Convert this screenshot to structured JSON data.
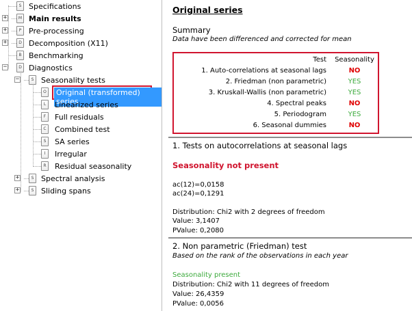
{
  "tree": {
    "items": [
      {
        "label": "Specifications",
        "icon": "S",
        "bold": false
      },
      {
        "label": "Main results",
        "icon": "M",
        "bold": true
      },
      {
        "label": "Pre-processing",
        "icon": "P",
        "bold": false
      },
      {
        "label": "Decomposition (X11)",
        "icon": "D",
        "bold": false
      },
      {
        "label": "Benchmarking",
        "icon": "B",
        "bold": false
      },
      {
        "label": "Diagnostics",
        "icon": "D",
        "bold": false
      },
      {
        "label": "Seasonality tests",
        "icon": "S",
        "bold": false
      },
      {
        "label": "Original (transformed) series",
        "icon": "O",
        "bold": false
      },
      {
        "label": "Linearized series",
        "icon": "L",
        "bold": false
      },
      {
        "label": "Full residuals",
        "icon": "F",
        "bold": false
      },
      {
        "label": "Combined test",
        "icon": "C",
        "bold": false
      },
      {
        "label": "SA series",
        "icon": "S",
        "bold": false
      },
      {
        "label": "Irregular",
        "icon": "I",
        "bold": false
      },
      {
        "label": "Residual seasonality",
        "icon": "R",
        "bold": false
      },
      {
        "label": "Spectral analysis",
        "icon": "S",
        "bold": false
      },
      {
        "label": "Sliding spans",
        "icon": "S",
        "bold": false
      }
    ],
    "expand_plus": "+",
    "expand_minus": "−"
  },
  "content": {
    "title": "Original series",
    "summary_heading": "Summary",
    "summary_note": "Data have been differenced and corrected for mean",
    "table": {
      "col_test": "Test",
      "col_seasonality": "Seasonality",
      "rows": [
        {
          "test": "1. Auto-correlations at seasonal lags",
          "result": "NO"
        },
        {
          "test": "2. Friedman (non parametric)",
          "result": "YES"
        },
        {
          "test": "3. Kruskall-Wallis (non parametric)",
          "result": "YES"
        },
        {
          "test": "4. Spectral peaks",
          "result": "NO"
        },
        {
          "test": "5. Periodogram",
          "result": "YES"
        },
        {
          "test": "6. Seasonal dummies",
          "result": "NO"
        }
      ]
    },
    "section1": {
      "heading": "1. Tests on autocorrelations at seasonal lags",
      "verdict": "Seasonality not present",
      "ac12": "ac(12)=0,0158",
      "ac24": "ac(24)=0,1291",
      "distribution": "Distribution: Chi2 with 2 degrees of freedom",
      "value": "Value: 3,1407",
      "pvalue": "PValue: 0,2080"
    },
    "section2": {
      "heading": "2. Non parametric (Friedman) test",
      "note": "Based on the rank of the observations in each year",
      "verdict": "Seasonality present",
      "distribution": "Distribution: Chi2 with 11 degrees of freedom",
      "value": "Value: 26,4359",
      "pvalue": "PValue: 0,0056"
    }
  },
  "colors": {
    "highlight_border": "#d0142e",
    "selection": "#3399ff",
    "no": "#e00000",
    "yes": "#3caa3c"
  }
}
